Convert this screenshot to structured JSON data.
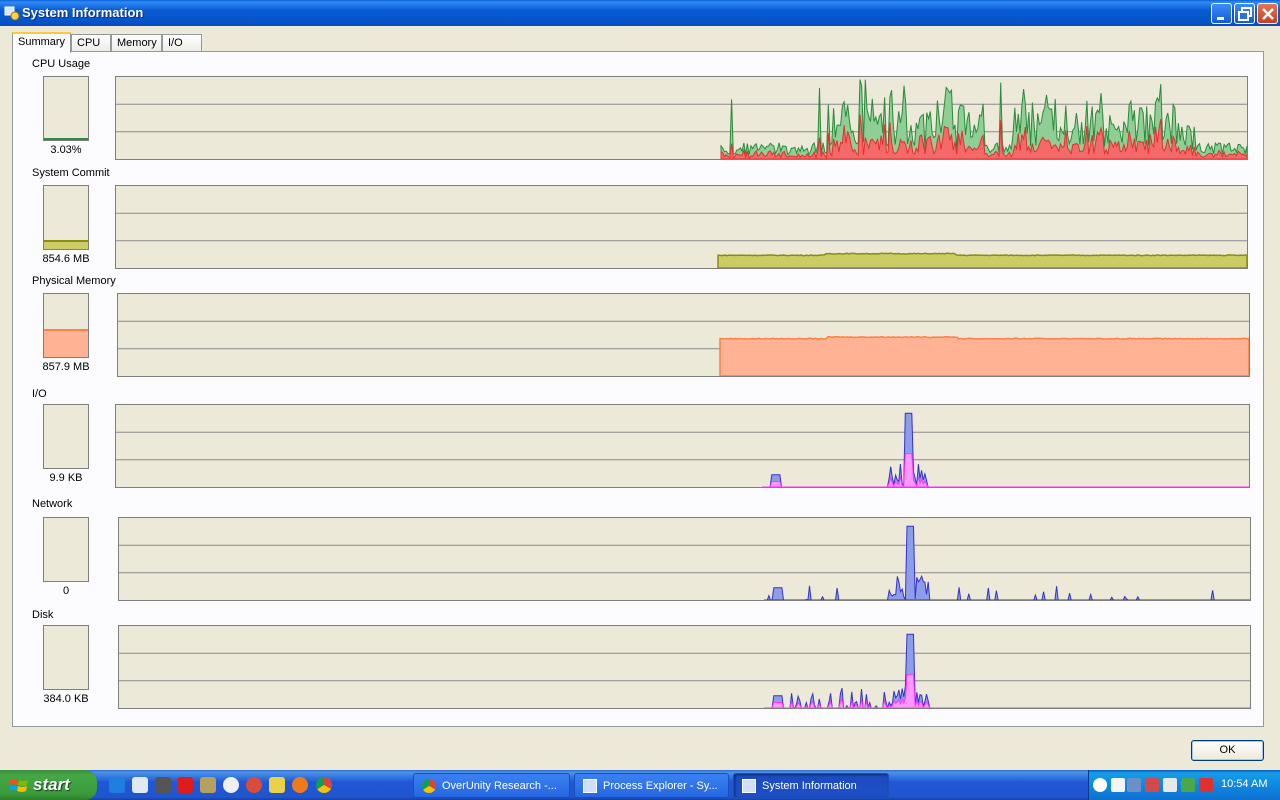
{
  "window": {
    "title": "System Information"
  },
  "tabs": [
    "Summary",
    "CPU",
    "Memory",
    "I/O"
  ],
  "sections": [
    {
      "label": "CPU Usage",
      "value": "3.03%",
      "level": 0.03,
      "colors": [
        "#2b8a3c",
        "#e62e2e"
      ]
    },
    {
      "label": "System Commit",
      "value": "854.6 MB",
      "level": 0.15,
      "colors": [
        "#8c8c10"
      ]
    },
    {
      "label": "Physical Memory",
      "value": "857.9 MB",
      "level": 0.45,
      "colors": [
        "#ff8040"
      ]
    },
    {
      "label": "I/O",
      "value": "9.9  KB",
      "level": 0,
      "colors": [
        "#3333cc",
        "#ff33ff"
      ]
    },
    {
      "label": "Network",
      "value": "0",
      "level": 0,
      "colors": [
        "#3333cc"
      ]
    },
    {
      "label": "Disk",
      "value": "384.0  KB",
      "level": 0,
      "colors": [
        "#3333cc",
        "#ff33ff"
      ]
    }
  ],
  "ok_button": "OK",
  "taskbar": {
    "start_label": "start",
    "tasks": [
      "OverUnity Research -...",
      "Process Explorer - Sy...",
      "System Information"
    ],
    "clock": "10:54 AM"
  }
}
